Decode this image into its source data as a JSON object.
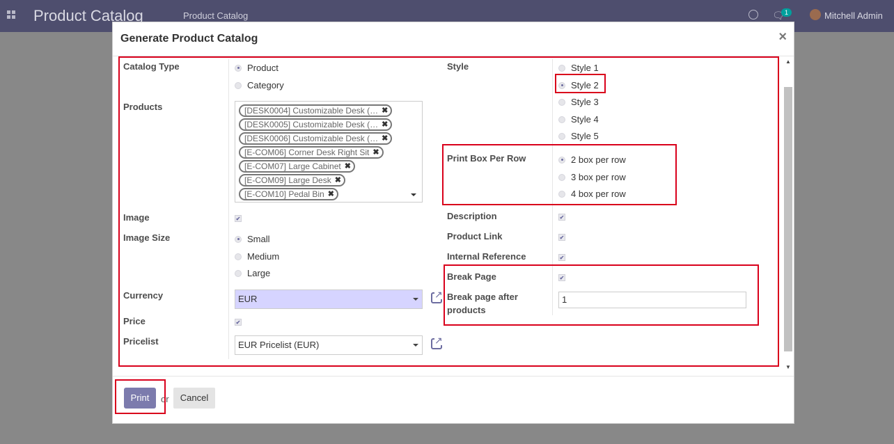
{
  "navbar": {
    "app_title": "Product Catalog",
    "breadcrumb": "Product Catalog",
    "chat_badge": "1",
    "user_name": "Mitchell Admin"
  },
  "modal": {
    "title": "Generate Product Catalog",
    "close_label": "×",
    "left": {
      "catalog_type_label": "Catalog Type",
      "catalog_type_options": [
        "Product",
        "Category"
      ],
      "catalog_type_selected": "Product",
      "products_label": "Products",
      "products": [
        "[DESK0004] Customizable Desk (…",
        "[DESK0005] Customizable Desk (…",
        "[DESK0006] Customizable Desk (…",
        "[E-COM06] Corner Desk Right Sit",
        "[E-COM07] Large Cabinet",
        "[E-COM09] Large Desk",
        "[E-COM10] Pedal Bin"
      ],
      "tag_remove": "✖",
      "image_label": "Image",
      "image_checked": true,
      "image_size_label": "Image Size",
      "image_size_options": [
        "Small",
        "Medium",
        "Large"
      ],
      "image_size_selected": "Small",
      "currency_label": "Currency",
      "currency_value": "EUR",
      "price_label": "Price",
      "price_checked": true,
      "pricelist_label": "Pricelist",
      "pricelist_value": "EUR Pricelist (EUR)"
    },
    "right": {
      "style_label": "Style",
      "style_options": [
        "Style 1",
        "Style 2",
        "Style 3",
        "Style 4",
        "Style 5"
      ],
      "style_selected": "Style 2",
      "box_per_row_label": "Print Box Per Row",
      "box_per_row_options": [
        "2 box per row",
        "3 box per row",
        "4 box per row"
      ],
      "box_per_row_selected": "2 box per row",
      "description_label": "Description",
      "product_link_label": "Product Link",
      "internal_ref_label": "Internal Reference",
      "break_page_label": "Break Page",
      "break_after_label_1": "Break page after",
      "break_after_label_2": "products",
      "break_after_value": "1"
    },
    "footer": {
      "print_label": "Print",
      "or_label": "or",
      "cancel_label": "Cancel"
    }
  },
  "colors": {
    "navbar": "#4e4e6e",
    "primary": "#7c7bad",
    "highlight": "#d9001b",
    "currency_select_bg": "#d6d4ff"
  },
  "icons": [
    "apps-grid-icon",
    "clock-icon",
    "chat-icon",
    "avatar",
    "external-link-icon",
    "close-icon",
    "caret-down-icon"
  ]
}
